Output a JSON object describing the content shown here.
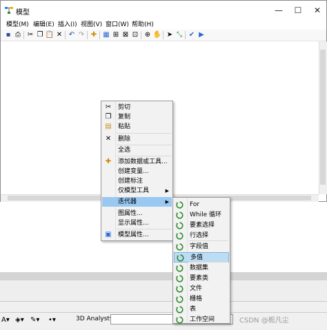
{
  "window": {
    "title": "模型",
    "controls": {
      "minimize": "—",
      "maximize": "☐",
      "close": "✕"
    }
  },
  "menubar": {
    "items": [
      "模型(M)",
      "编辑(E)",
      "插入(I)",
      "视图(V)",
      "窗口(W)",
      "帮助(H)"
    ]
  },
  "toolbar": {
    "icons": [
      "save-icon",
      "print-icon",
      "cut-icon",
      "copy-icon",
      "paste-icon",
      "delete-icon",
      "undo-icon",
      "redo-icon",
      "add-data-icon",
      "auto-layout-icon",
      "full-extent-icon",
      "fixed-zoom-in-icon",
      "fixed-zoom-out-icon",
      "zoom-in-icon",
      "pan-icon",
      "select-icon",
      "connect-icon",
      "validate-icon",
      "run-icon"
    ]
  },
  "context_menu": {
    "items": [
      {
        "label": "剪切",
        "icon": "scissors-icon"
      },
      {
        "label": "复制",
        "icon": "copy-icon"
      },
      {
        "label": "粘贴",
        "icon": "paste-icon"
      },
      {
        "label": "删除",
        "icon": "delete-x-icon"
      },
      {
        "label": "全选",
        "icon": ""
      },
      {
        "label": "添加数据或工具...",
        "icon": "add-data-icon"
      },
      {
        "label": "创建变量...",
        "icon": ""
      },
      {
        "label": "创建标注",
        "icon": ""
      },
      {
        "label": "仅模型工具",
        "icon": "",
        "submenu": true
      },
      {
        "label": "迭代器",
        "icon": "",
        "submenu": true,
        "highlighted": true
      },
      {
        "label": "图属性...",
        "icon": ""
      },
      {
        "label": "显示属性...",
        "icon": ""
      },
      {
        "label": "模型属性...",
        "icon": "model-properties-icon"
      }
    ]
  },
  "iterator_submenu": {
    "items": [
      {
        "label": "For"
      },
      {
        "label": "While 循环"
      },
      {
        "label": "要素选择"
      },
      {
        "label": "行选择"
      },
      {
        "label": "字段值"
      },
      {
        "label": "多值",
        "highlighted": true
      },
      {
        "label": "数据集"
      },
      {
        "label": "要素类"
      },
      {
        "label": "文件"
      },
      {
        "label": "栅格"
      },
      {
        "label": "表"
      },
      {
        "label": "工作空间"
      }
    ]
  },
  "background_app": {
    "analyst_label": "3D Analyst▾",
    "watermark": "CSDN @栀凡尘"
  },
  "colors": {
    "menu_highlight": "#99c8f0",
    "submenu_highlight": "#bcdcf4",
    "iterator_icon": "#2e8b2e"
  }
}
